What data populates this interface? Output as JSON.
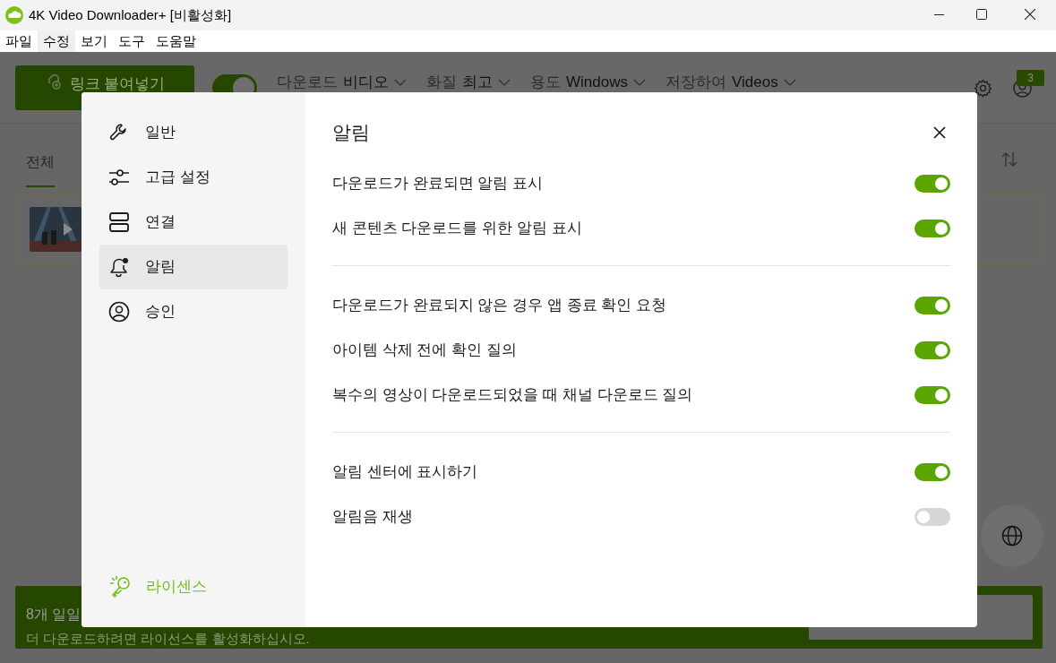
{
  "window": {
    "title": "4K Video Downloader+ [비활성화]"
  },
  "menu": [
    {
      "label": "파일",
      "selected": false
    },
    {
      "label": "수정",
      "selected": true
    },
    {
      "label": "보기",
      "selected": false
    },
    {
      "label": "도구",
      "selected": false
    },
    {
      "label": "도움말",
      "selected": false
    }
  ],
  "toolbar": {
    "paste_button": "링크 붙여넣기",
    "smart_mode_on": true,
    "options": [
      {
        "label": "다운로드",
        "value": "비디오"
      },
      {
        "label": "화질",
        "value": "최고"
      },
      {
        "label": "용도",
        "value": "Windows"
      },
      {
        "label": "저장하여",
        "value": "Videos"
      }
    ],
    "badge": "3"
  },
  "tabs": [
    {
      "label": "전체",
      "selected": true
    }
  ],
  "banner": {
    "title": "8개 일일",
    "text": "더 다운로드하려면 라이선스를 활성화하십시오."
  },
  "dialog": {
    "sidebar": [
      {
        "label": "일반",
        "selected": false
      },
      {
        "label": "고급 설정",
        "selected": false
      },
      {
        "label": "연결",
        "selected": false
      },
      {
        "label": "알림",
        "selected": true
      },
      {
        "label": "승인",
        "selected": false
      }
    ],
    "license": "라이센스",
    "title": "알림",
    "sections": [
      [
        {
          "label": "다운로드가 완료되면 알림 표시",
          "on": true
        },
        {
          "label": "새 콘텐츠 다운로드를 위한 알림 표시",
          "on": true
        }
      ],
      [
        {
          "label": "다운로드가 완료되지 않은 경우 앱 종료 확인 요청",
          "on": true
        },
        {
          "label": "아이템 삭제 전에 확인 질의",
          "on": true
        },
        {
          "label": "복수의 영상이 다운로드되었을 때 채널 다운로드 질의",
          "on": true
        }
      ],
      [
        {
          "label": "알림 센터에 표시하기",
          "on": true
        },
        {
          "label": "알림음 재생",
          "on": false
        }
      ]
    ]
  }
}
